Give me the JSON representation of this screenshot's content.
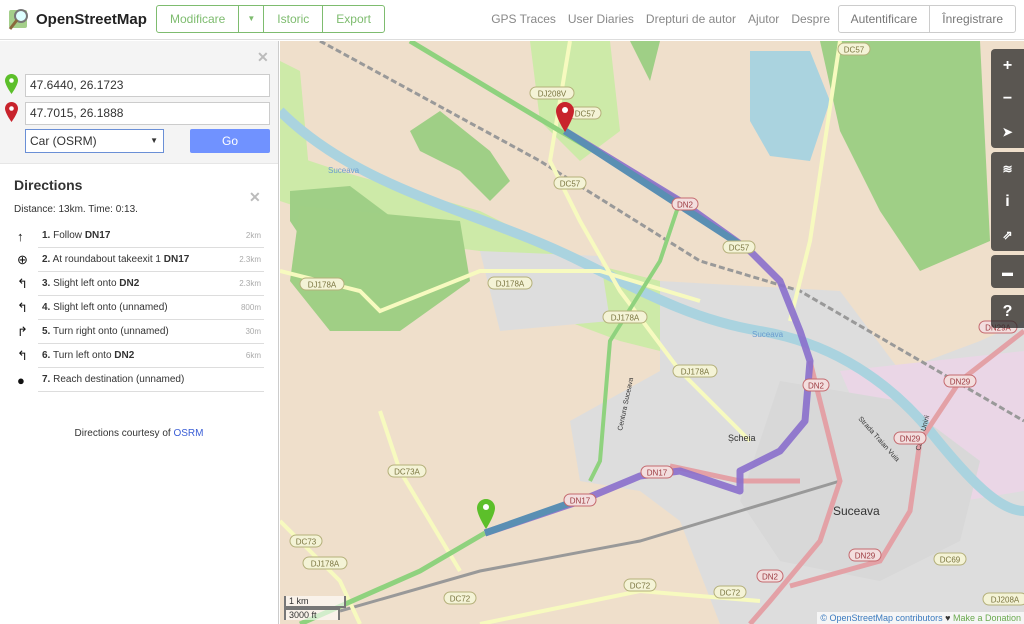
{
  "header": {
    "brand": "OpenStreetMap",
    "edit_label": "Modificare",
    "history_label": "Istoric",
    "export_label": "Export",
    "nav": [
      "GPS Traces",
      "User Diaries",
      "Drepturi de autor",
      "Ajutor",
      "Despre"
    ],
    "login_label": "Autentificare",
    "signup_label": "Înregistrare"
  },
  "route": {
    "from": "47.6440, 26.1723",
    "to": "47.7015, 26.1888",
    "mode": "Car (OSRM)",
    "go_label": "Go"
  },
  "directions": {
    "title": "Directions",
    "summary": "Distance: 13km. Time: 0:13.",
    "steps": [
      {
        "num": "1.",
        "text": "Follow ",
        "road": "DN17",
        "dist": "2km",
        "icon": "↑"
      },
      {
        "num": "2.",
        "text": "At roundabout takeexit 1 ",
        "road": "DN17",
        "dist": "2.3km",
        "icon": "⊕"
      },
      {
        "num": "3.",
        "text": "Slight left onto ",
        "road": "DN2",
        "dist": "2.3km",
        "icon": "↰"
      },
      {
        "num": "4.",
        "text": "Slight left onto (unnamed)",
        "road": "",
        "dist": "800m",
        "icon": "↰"
      },
      {
        "num": "5.",
        "text": "Turn right onto (unnamed)",
        "road": "",
        "dist": "30m",
        "icon": "↱"
      },
      {
        "num": "6.",
        "text": "Turn left onto ",
        "road": "DN2",
        "dist": "6km",
        "icon": "↰"
      },
      {
        "num": "7.",
        "text": "Reach destination (unnamed)",
        "road": "",
        "dist": "",
        "icon": "●"
      }
    ],
    "courtesy_prefix": "Directions courtesy of ",
    "courtesy_link": "OSRM"
  },
  "map": {
    "controls": [
      "zoom-in",
      "zoom-out",
      "locate",
      "layers",
      "info",
      "share",
      "note",
      "help"
    ],
    "scale_metric": "1 km",
    "scale_imperial": "3000 ft",
    "attribution": "© OpenStreetMap contributors",
    "donation": "Make a Donation",
    "labels": {
      "city": "Suceava",
      "village": "Șcheia",
      "river": "Suceava",
      "street_traian": "Strada Traian Vuia",
      "street_unirii": "Calea Unirii",
      "centura": "Centura Suceava"
    },
    "road_shields": [
      "DJ208V",
      "DC57",
      "DC57",
      "DC57",
      "DN2",
      "DC57",
      "DJ178A",
      "DJ178A",
      "DJ178A",
      "DJ178A",
      "DJ178A",
      "DN2",
      "DN29",
      "DN29A",
      "DN29",
      "DN17",
      "DN17",
      "DC73A",
      "DC73",
      "DC72",
      "DC72",
      "DC72",
      "DN29",
      "DN2",
      "DC69",
      "DJ208A"
    ]
  }
}
